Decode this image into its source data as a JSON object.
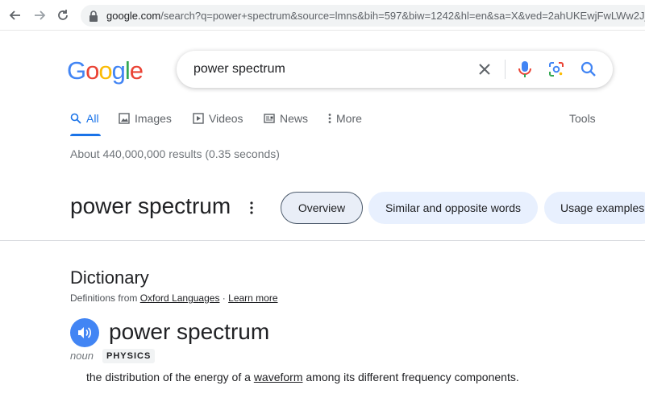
{
  "browser": {
    "url_host": "google.com",
    "url_rest": "/search?q=power+spectrum&source=lmns&bih=597&biw=1242&hl=en&sa=X&ved=2ahUKEwjFwLWw2J_"
  },
  "logo": {
    "letters": [
      "G",
      "o",
      "o",
      "g",
      "l",
      "e"
    ],
    "colors": [
      "#4285f4",
      "#ea4335",
      "#fbbc05",
      "#4285f4",
      "#34a853",
      "#ea4335"
    ]
  },
  "search": {
    "query": "power spectrum"
  },
  "tabs": [
    {
      "label": "All",
      "active": true
    },
    {
      "label": "Images"
    },
    {
      "label": "Videos"
    },
    {
      "label": "News"
    },
    {
      "label": "More"
    }
  ],
  "tools_label": "Tools",
  "result_stats": "About 440,000,000 results (0.35 seconds)",
  "knowledge": {
    "title": "power spectrum",
    "chips": [
      "Overview",
      "Similar and opposite words",
      "Usage examples"
    ]
  },
  "dictionary": {
    "heading": "Dictionary",
    "source_prefix": "Definitions from",
    "source_link": "Oxford Languages",
    "source_sep": " · ",
    "learn_more": "Learn more",
    "headword": "power spectrum",
    "part_of_speech": "noun",
    "domain": "PHYSICS",
    "definition_before": "the distribution of the energy of a ",
    "definition_link": "waveform",
    "definition_after": " among its different frequency components."
  },
  "colors": {
    "accent": "#1a73e8",
    "speaker": "#4285f4"
  }
}
